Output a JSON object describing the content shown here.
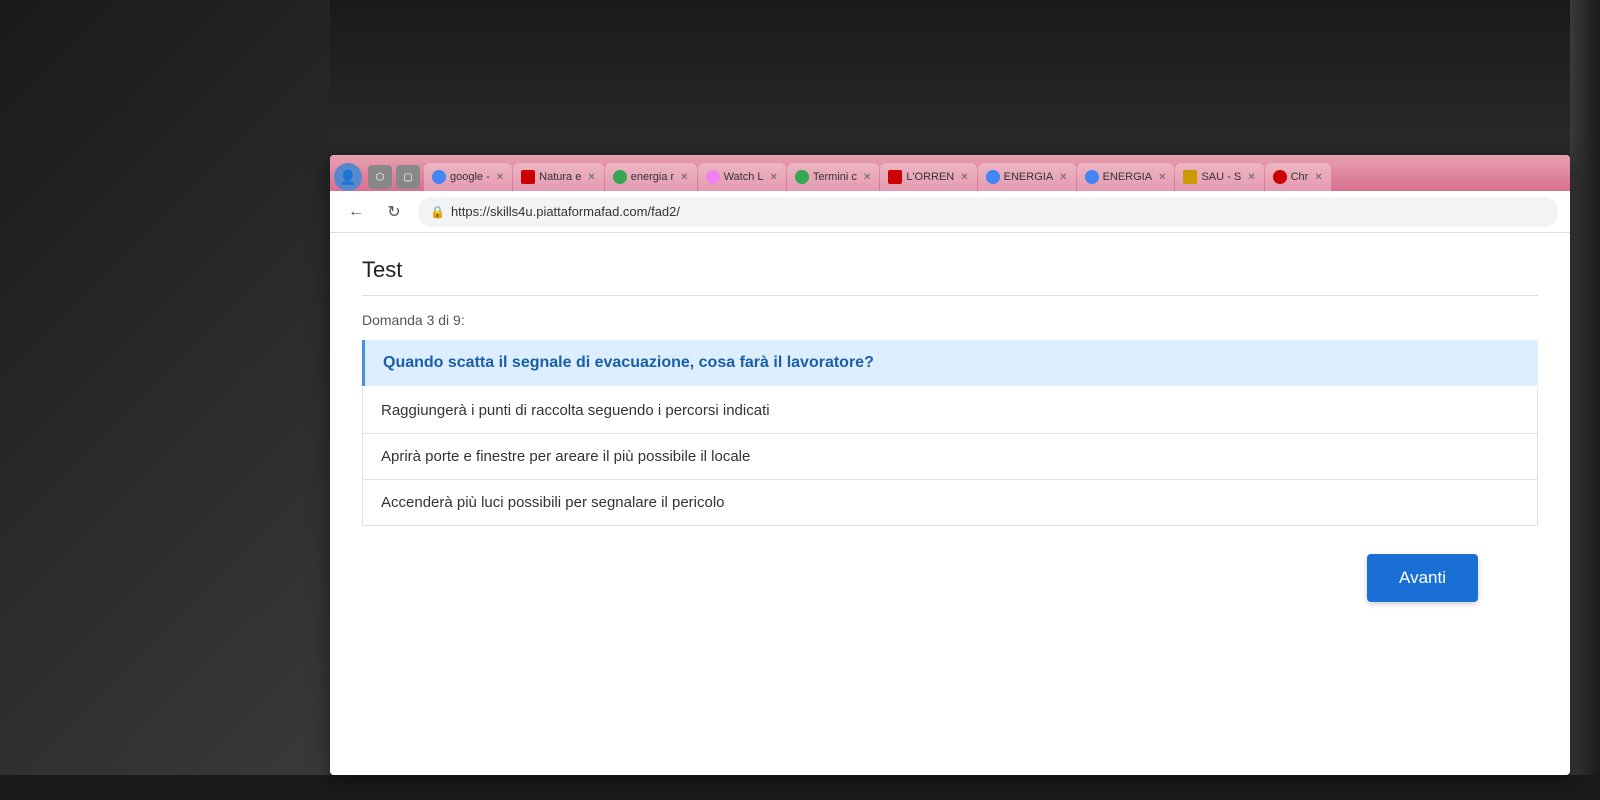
{
  "browser": {
    "url": "https://skills4u.piattaformafad.com/fad2/",
    "tabs": [
      {
        "label": "google -",
        "favicon_color": "#4285f4",
        "active": false
      },
      {
        "label": "Natura e",
        "favicon_color": "#cc0000",
        "active": false
      },
      {
        "label": "energia r",
        "favicon_color": "#34a853",
        "active": false
      },
      {
        "label": "Watch L",
        "favicon_color": "#ee82ee",
        "active": false
      },
      {
        "label": "Termini c",
        "favicon_color": "#34a853",
        "active": false
      },
      {
        "label": "L'ORREN",
        "favicon_color": "#cc0000",
        "active": false
      },
      {
        "label": "ENERGIA",
        "favicon_color": "#4285f4",
        "active": false
      },
      {
        "label": "ENERGIA",
        "favicon_color": "#4285f4",
        "active": false
      },
      {
        "label": "SAU - S",
        "favicon_color": "#cc9900",
        "active": false
      },
      {
        "label": "Chr",
        "favicon_color": "#cc0000",
        "active": false
      }
    ]
  },
  "page": {
    "title": "Test",
    "question_counter": "Domanda 3 di 9:",
    "question_text": "Quando scatta il segnale di evacuazione, cosa farà il lavoratore?",
    "answers": [
      "Raggiungerà i punti di raccolta seguendo i percorsi indicati",
      "Aprirà porte e finestre per areare il più possibile il locale",
      "Accenderà più luci possibili per segnalare il pericolo"
    ],
    "next_button_label": "Avanti"
  },
  "colors": {
    "tab_bar_bg": "#d97090",
    "question_bg": "#dceeff",
    "question_text_color": "#1a5fa8",
    "avanti_btn_color": "#1a6fd4"
  }
}
